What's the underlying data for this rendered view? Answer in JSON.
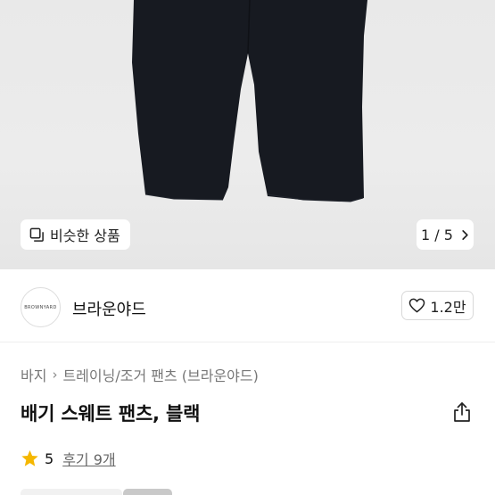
{
  "gallery": {
    "similar_label": "비슷한 상품",
    "page_indicator": "1 / 5"
  },
  "brand": {
    "logo_text": "BROWNYARD",
    "name": "브라운야드",
    "likes": "1.2만"
  },
  "breadcrumb": {
    "items": [
      "바지",
      "트레이닝/조거 팬츠 (브라운야드)"
    ]
  },
  "product": {
    "title": "배기 스웨트 팬츠, 블랙"
  },
  "rating": {
    "score": "5",
    "reviews": "후기 9개"
  },
  "colors": {
    "star": "#f5b700",
    "pants": "#181b22"
  }
}
